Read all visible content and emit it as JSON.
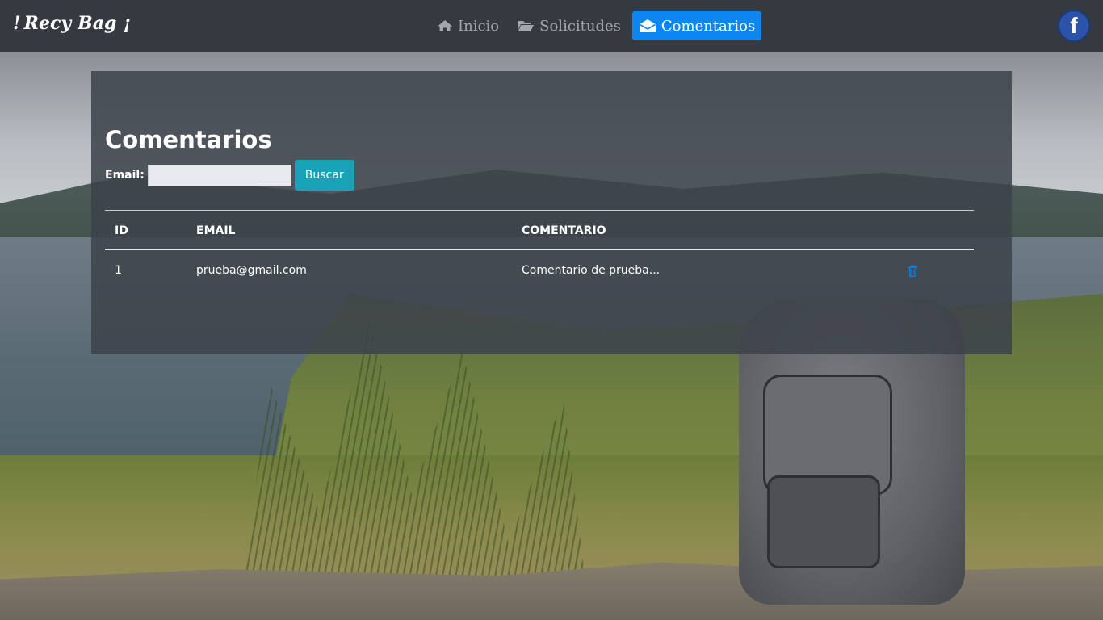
{
  "brand": {
    "prefix": "!",
    "word1": "Recy",
    "word2": "Bag",
    "suffix": "¡"
  },
  "nav": {
    "items": [
      {
        "label": "Inicio",
        "icon": "home-icon",
        "active": false
      },
      {
        "label": "Solicitudes",
        "icon": "folder-open-icon",
        "active": false
      },
      {
        "label": "Comentarios",
        "icon": "envelope-open-icon",
        "active": true
      }
    ],
    "social_icon": "facebook-icon"
  },
  "colors": {
    "navbar": "#343a40",
    "active": "#0d86f2",
    "search_button": "#17a2b8"
  },
  "main": {
    "title": "Comentarios",
    "search": {
      "label": "Email:",
      "value": "",
      "placeholder": "",
      "button": "Buscar"
    },
    "table": {
      "headers": [
        "ID",
        "EMAIL",
        "COMENTARIO"
      ],
      "rows": [
        {
          "id": "1",
          "email": "prueba@gmail.com",
          "comentario": "Comentario de prueba...",
          "action_icon": "trash-icon"
        }
      ]
    }
  }
}
